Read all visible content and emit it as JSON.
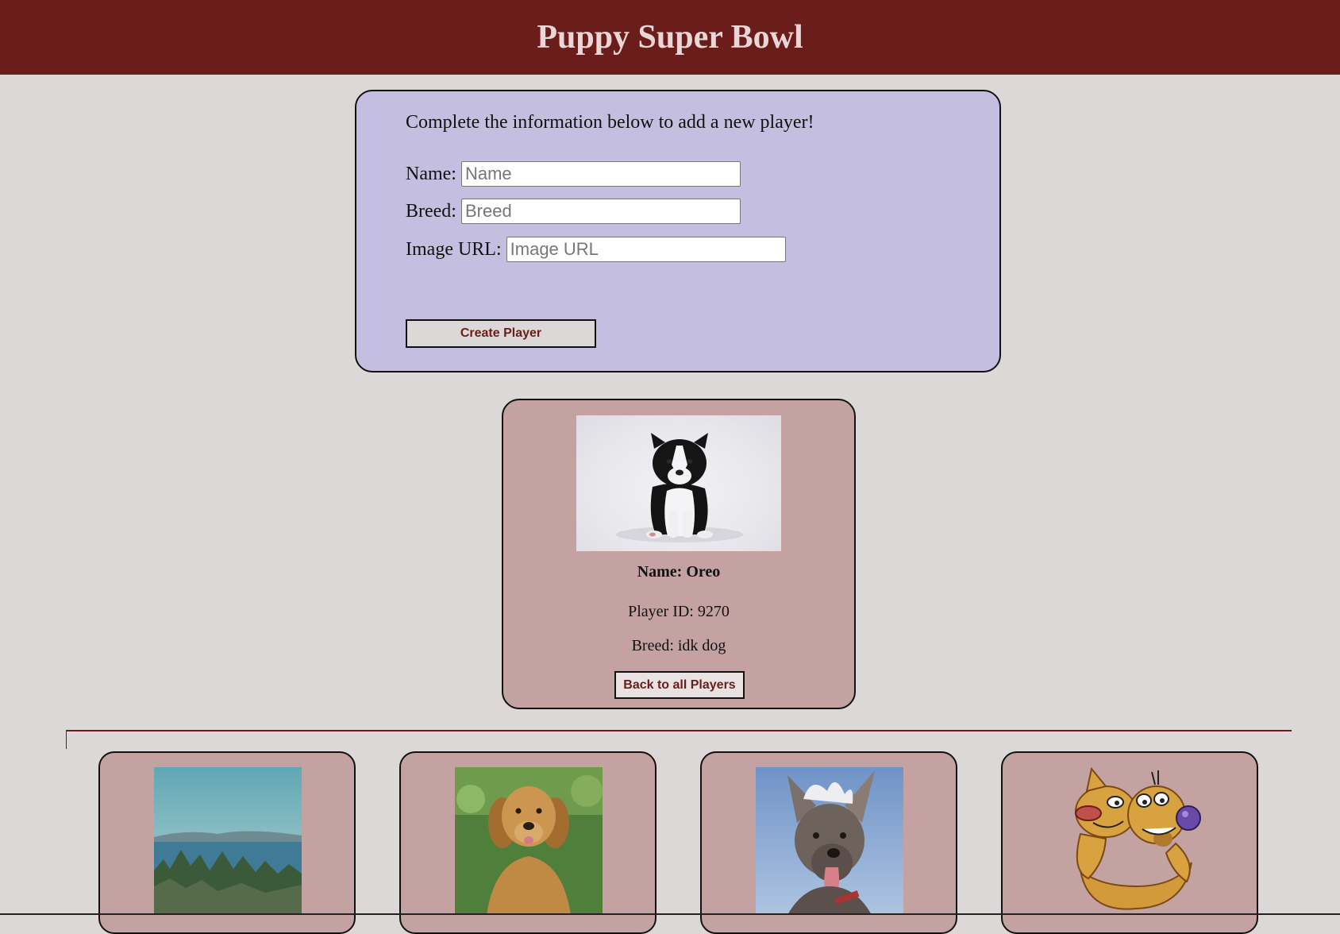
{
  "header": {
    "title": "Puppy Super Bowl"
  },
  "form": {
    "intro": "Complete the information below to add a new player!",
    "name_label": "Name:",
    "name_placeholder": "Name",
    "breed_label": "Breed:",
    "breed_placeholder": "Breed",
    "image_label": "Image URL:",
    "image_placeholder": "Image URL",
    "submit_label": "Create Player"
  },
  "detail": {
    "name": "Name: Oreo",
    "player_id": "Player ID: 9270",
    "breed": "Breed: idk dog",
    "back_label": "Back to all Players",
    "image": "black-and-white-puppy-photo"
  },
  "players": [
    {
      "image": "landscape-trees-lake-photo"
    },
    {
      "image": "golden-retriever-photo"
    },
    {
      "image": "hairless-dog-tongue-photo"
    },
    {
      "image": "cartoon-catdog-image"
    }
  ],
  "colors": {
    "header_bg": "#6a1d1a",
    "page_bg": "#ddd8d8",
    "form_bg": "#c4bfe1",
    "card_bg": "#c4a2a2",
    "button_text": "#6a1d1a"
  }
}
